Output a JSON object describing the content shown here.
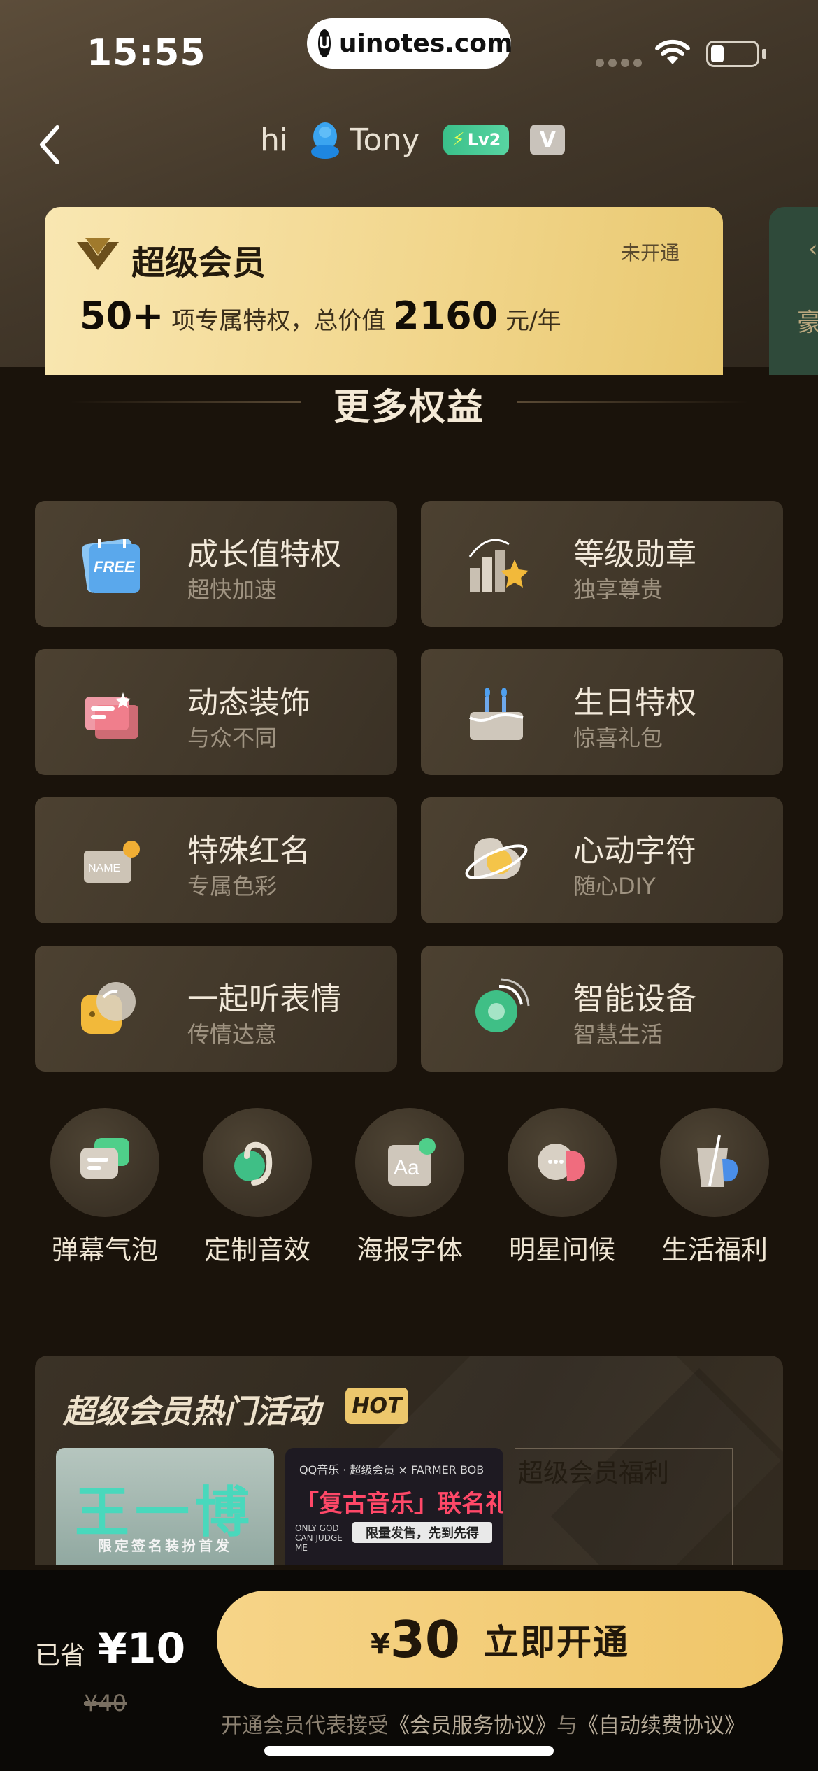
{
  "status_bar": {
    "time": "15:55",
    "url": "uinotes.com"
  },
  "header": {
    "greeting": "hi",
    "username": "Tony",
    "level_badge": "Lv2",
    "vip_badge": "V"
  },
  "svip_card": {
    "title": "超级会员",
    "status": "未开通",
    "count": "50+",
    "desc_mid": " 项专属特权，总价值 ",
    "total": "2160",
    "unit": " 元/年"
  },
  "side_card": {
    "text": "豪",
    "arrow": "‹"
  },
  "section": {
    "title": "更多权益"
  },
  "privileges": [
    {
      "title": "成长值特权",
      "subtitle": "超快加速",
      "icon": "free-calendar-icon"
    },
    {
      "title": "等级勋章",
      "subtitle": "独享尊贵",
      "icon": "level-medal-icon"
    },
    {
      "title": "动态装饰",
      "subtitle": "与众不同",
      "icon": "dynamic-card-icon"
    },
    {
      "title": "生日特权",
      "subtitle": "惊喜礼包",
      "icon": "birthday-cake-icon"
    },
    {
      "title": "特殊红名",
      "subtitle": "专属色彩",
      "icon": "name-tag-icon"
    },
    {
      "title": "心动字符",
      "subtitle": "随心DIY",
      "icon": "planet-heart-icon"
    },
    {
      "title": "一起听表情",
      "subtitle": "传情达意",
      "icon": "emoji-listen-icon"
    },
    {
      "title": "智能设备",
      "subtitle": "智慧生活",
      "icon": "smart-device-icon"
    }
  ],
  "quick_items": [
    {
      "label": "弹幕气泡",
      "icon": "bubble-icon"
    },
    {
      "label": "定制音效",
      "icon": "ear-sound-icon"
    },
    {
      "label": "海报字体",
      "icon": "font-aa-icon"
    },
    {
      "label": "明星问候",
      "icon": "star-greeting-icon"
    },
    {
      "label": "生活福利",
      "icon": "cup-icon"
    }
  ],
  "hot": {
    "title": "超级会员热门活动",
    "badge": "HOT",
    "tile1_big": "王一博",
    "tile1_small": "限定签名装扮首发",
    "tile2_header": "QQ音乐 · 超级会员 × FARMER BOB",
    "tile2_title": "「复古音乐」联名礼盒",
    "tile2_small": "ONLY GOD CAN JUDGE ME",
    "tile2_chip": "限量发售，先到先得",
    "tile3_text": "超级会员福利"
  },
  "bottom": {
    "saved_label": "已省",
    "saved_amount": "¥10",
    "original_price": "¥40",
    "cta_yen": "¥",
    "cta_price": "30",
    "cta_label": "立即开通",
    "agree_prefix": "开通会员代表接受",
    "agree_link1": "《会员服务协议》",
    "agree_mid": "与",
    "agree_link2": "《自动续费协议》"
  },
  "colors": {
    "accent_gold": "#f0c669",
    "background": "#1a130b",
    "card": "#43392b"
  }
}
